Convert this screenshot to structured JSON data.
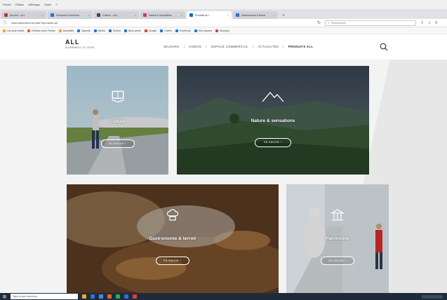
{
  "browser": {
    "menu": [
      "Fichier",
      "Édition",
      "Affichage",
      "Outils",
      "?"
    ],
    "tabs": [
      {
        "label": "Accueil – ALL",
        "color": "#c0392b"
      },
      {
        "label": "Découvrir le territoire",
        "color": "#2e6fd8"
      },
      {
        "label": "Culture – ALL",
        "color": "#444444"
      },
      {
        "label": "Nature & sensations",
        "color": "#d6336c"
      },
      {
        "label": "Produits ALL",
        "color": "#1565c0",
        "active": true
      },
      {
        "label": "Gastronomie & terroir",
        "color": "#2e6fd8"
      }
    ],
    "url": "www.autrement-le-loisir.fr/produits-all",
    "search_placeholder": "Rechercher",
    "bookmarks": [
      {
        "label": "Les plus visités",
        "color": "#f5a623"
      },
      {
        "label": "Débuter avec Firefox",
        "color": "#e8632a"
      },
      {
        "label": "Actualités",
        "color": "#f5a623"
      },
      {
        "label": "Agenda",
        "color": "#2e6fd8"
      },
      {
        "label": "Météo",
        "color": "#2e6fd8"
      },
      {
        "label": "Sorties",
        "color": "#2e6fd8"
      },
      {
        "label": "Bons plans",
        "color": "#2e6fd8"
      },
      {
        "label": "Google",
        "color": "#db4437"
      },
      {
        "label": "Cartes",
        "color": "#2e6fd8"
      },
      {
        "label": "Facebook",
        "color": "#1877f2"
      },
      {
        "label": "Mon espace",
        "color": "#2e6fd8"
      },
      {
        "label": "Musique",
        "color": "#e53935"
      }
    ]
  },
  "site": {
    "logo_mark": "ALL",
    "logo_sub": "AUTREMENT LE LOISIR",
    "nav": [
      "SÉJOURS",
      "VIDÉOS",
      "ESPACE COMMERCIAL",
      "ACTUALITÉS",
      "PRODUITS ALL"
    ],
    "nav_sep": "|"
  },
  "tiles": {
    "culture": {
      "label": "Culture",
      "button": "EN SAVOIR +",
      "icon": "book-icon"
    },
    "nature": {
      "label": "Nature & sensations",
      "button": "EN SAVOIR +",
      "icon": "mountain-icon"
    },
    "gastronomie": {
      "label": "Gastronomie & terroir",
      "button": "EN SAVOIR +",
      "icon": "chef-hat-icon"
    },
    "patrimoine": {
      "label": "Patrimoine",
      "button": "EN SAVOIR +",
      "icon": "monument-icon"
    }
  },
  "taskbar": {
    "search_placeholder": "Taper ici pour rechercher",
    "app_colors": [
      "#f5a623",
      "#2e6fd8",
      "#3a8ee6",
      "#e8632a",
      "#27ae60",
      "#2e6fd8",
      "#e53935"
    ]
  }
}
